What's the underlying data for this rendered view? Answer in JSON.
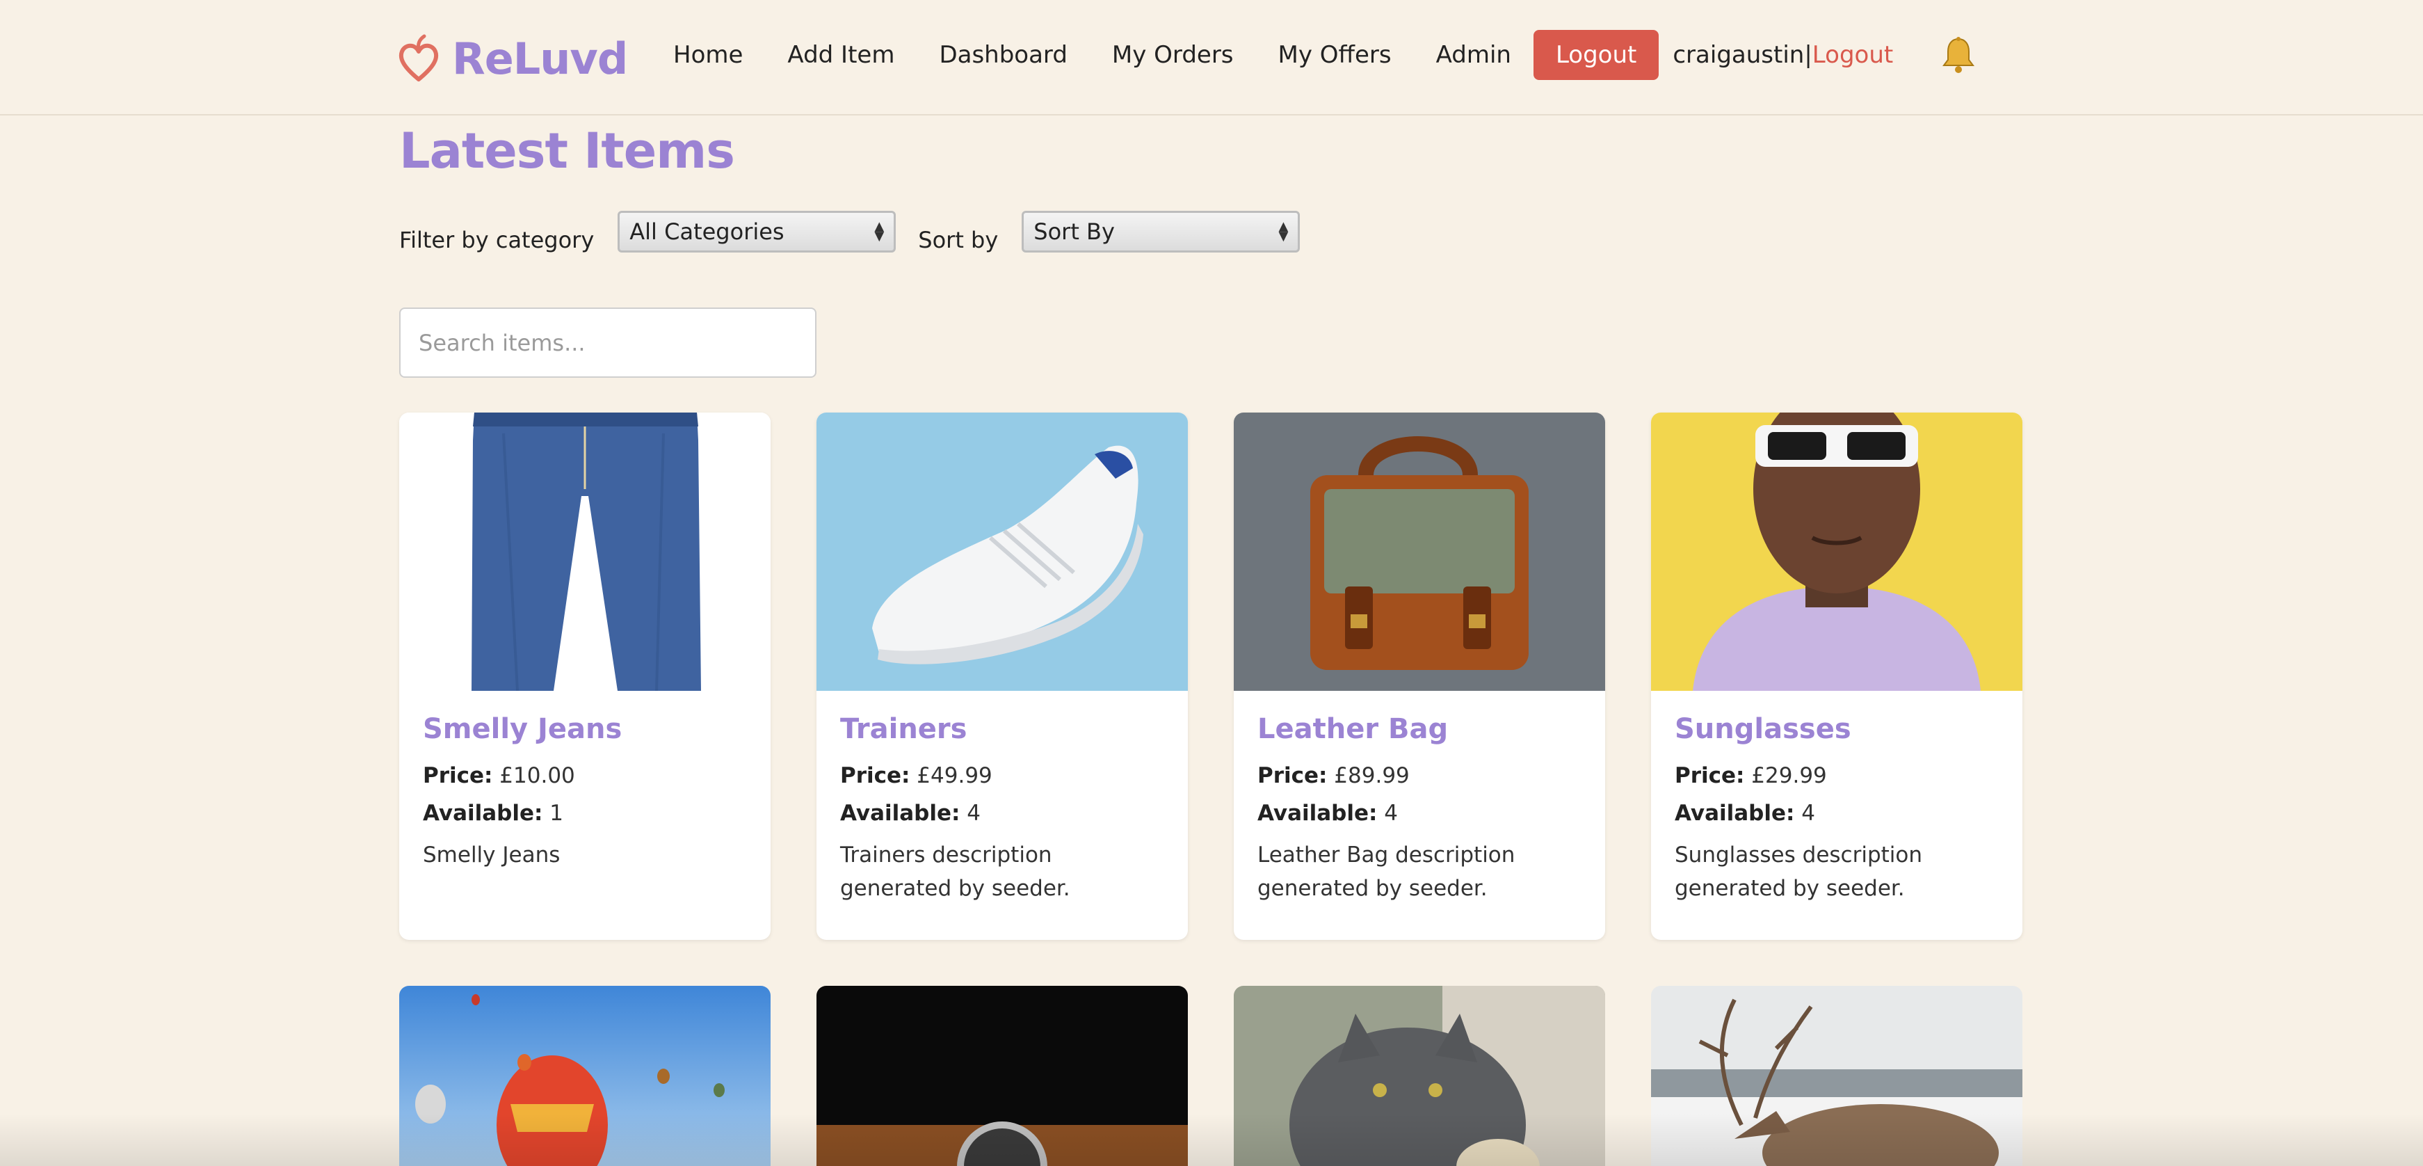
{
  "brand": {
    "name": "ReLuvd",
    "logo_icon": "heart-icon",
    "accent": "#9b83d3"
  },
  "nav": {
    "items": [
      "Home",
      "Add Item",
      "Dashboard",
      "My Orders",
      "My Offers",
      "Admin"
    ],
    "logout_button": "Logout",
    "username": "craigaustin",
    "separator": "|",
    "user_logout": "Logout",
    "notification_icon": "bell-icon",
    "logout_color": "#d9594c"
  },
  "page": {
    "title": "Latest Items"
  },
  "filters": {
    "category_label": "Filter by category",
    "category_value": "All Categories",
    "sort_label": "Sort by",
    "sort_value": "Sort By"
  },
  "search": {
    "placeholder": "Search items...",
    "value": ""
  },
  "items": [
    {
      "title": "Smelly Jeans",
      "price_label": "Price:",
      "price": "£10.00",
      "available_label": "Available:",
      "available": "1",
      "description": "Smelly Jeans",
      "image": "jeans-image"
    },
    {
      "title": "Trainers",
      "price_label": "Price:",
      "price": "£49.99",
      "available_label": "Available:",
      "available": "4",
      "description": "Trainers description generated by seeder.",
      "image": "trainer-shoe-image"
    },
    {
      "title": "Leather Bag",
      "price_label": "Price:",
      "price": "£89.99",
      "available_label": "Available:",
      "available": "4",
      "description": "Leather Bag description generated by seeder.",
      "image": "leather-bag-image"
    },
    {
      "title": "Sunglasses",
      "price_label": "Price:",
      "price": "£29.99",
      "available_label": "Available:",
      "available": "4",
      "description": "Sunglasses description generated by seeder.",
      "image": "sunglasses-model-image"
    }
  ],
  "more_items": [
    "hot-air-balloon-image",
    "watch-image",
    "cat-image",
    "reindeer-image"
  ]
}
